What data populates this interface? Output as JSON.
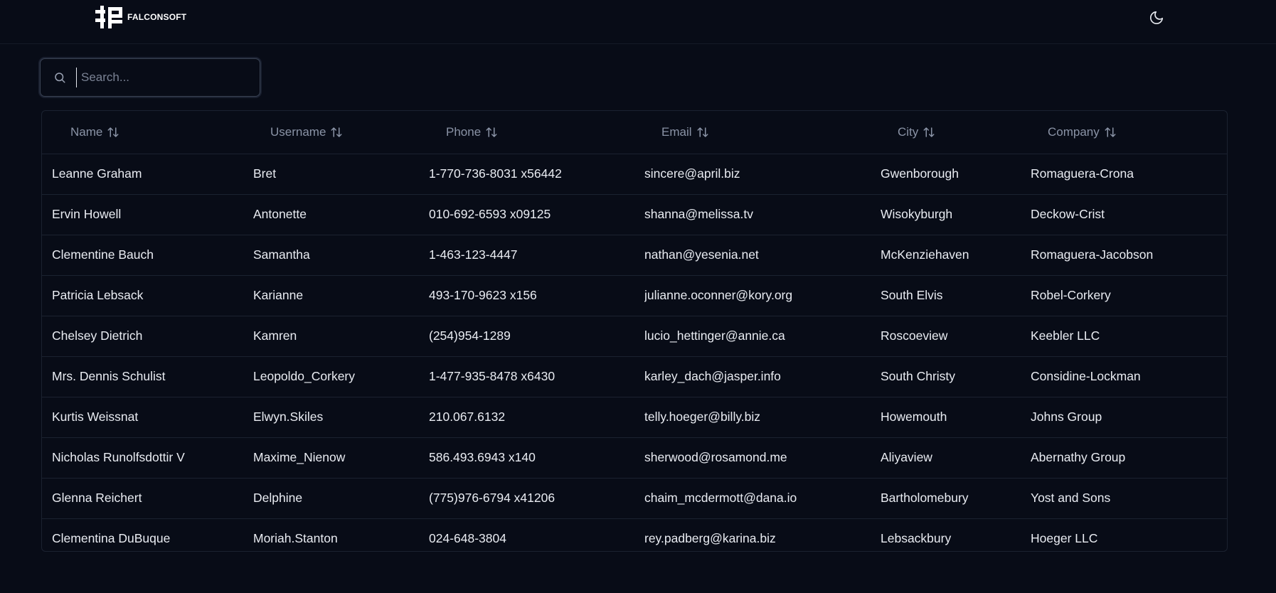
{
  "header": {
    "logo_text": "FALCONSOFT",
    "theme_icon": "moon-icon"
  },
  "search": {
    "placeholder": "Search...",
    "value": ""
  },
  "table": {
    "columns": [
      "Name",
      "Username",
      "Phone",
      "Email",
      "City",
      "Company"
    ],
    "rows": [
      [
        "Leanne Graham",
        "Bret",
        "1-770-736-8031 x56442",
        "sincere@april.biz",
        "Gwenborough",
        "Romaguera-Crona"
      ],
      [
        "Ervin Howell",
        "Antonette",
        "010-692-6593 x09125",
        "shanna@melissa.tv",
        "Wisokyburgh",
        "Deckow-Crist"
      ],
      [
        "Clementine Bauch",
        "Samantha",
        "1-463-123-4447",
        "nathan@yesenia.net",
        "McKenziehaven",
        "Romaguera-Jacobson"
      ],
      [
        "Patricia Lebsack",
        "Karianne",
        "493-170-9623 x156",
        "julianne.oconner@kory.org",
        "South Elvis",
        "Robel-Corkery"
      ],
      [
        "Chelsey Dietrich",
        "Kamren",
        "(254)954-1289",
        "lucio_hettinger@annie.ca",
        "Roscoeview",
        "Keebler LLC"
      ],
      [
        "Mrs. Dennis Schulist",
        "Leopoldo_Corkery",
        "1-477-935-8478 x6430",
        "karley_dach@jasper.info",
        "South Christy",
        "Considine-Lockman"
      ],
      [
        "Kurtis Weissnat",
        "Elwyn.Skiles",
        "210.067.6132",
        "telly.hoeger@billy.biz",
        "Howemouth",
        "Johns Group"
      ],
      [
        "Nicholas Runolfsdottir V",
        "Maxime_Nienow",
        "586.493.6943 x140",
        "sherwood@rosamond.me",
        "Aliyaview",
        "Abernathy Group"
      ],
      [
        "Glenna Reichert",
        "Delphine",
        "(775)976-6794 x41206",
        "chaim_mcdermott@dana.io",
        "Bartholomebury",
        "Yost and Sons"
      ],
      [
        "Clementina DuBuque",
        "Moriah.Stanton",
        "024-648-3804",
        "rey.padberg@karina.biz",
        "Lebsackbury",
        "Hoeger LLC"
      ]
    ]
  }
}
